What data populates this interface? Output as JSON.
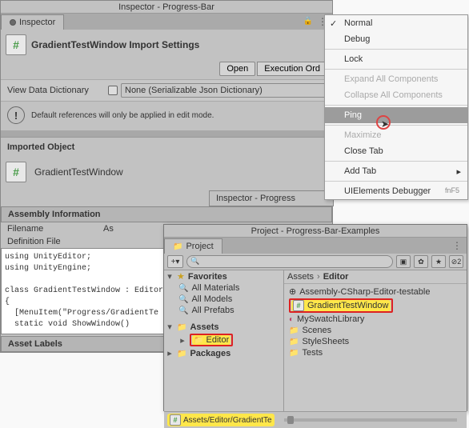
{
  "inspector": {
    "window_title": "Inspector - Progress-Bar",
    "tab_label": "Inspector",
    "header": "GradientTestWindow Import Settings",
    "open_btn": "Open",
    "exec_btn": "Execution Ord",
    "view_data_label": "View Data Dictionary",
    "view_data_value": "None (Serializable Json Dictionary)",
    "info_msg": "Default references will only be applied in edit mode.",
    "imported_label": "Imported Object",
    "imported_name": "GradientTestWindow",
    "inner_tab": "Inspector - Progress",
    "assembly_hdr": "Assembly Information",
    "filename_k": "Filename",
    "filename_v": "As",
    "deffile_k": "Definition File",
    "code": "using UnityEditor;\nusing UnityEngine;\n\nclass GradientTestWindow : EditorW\n{\n  [MenuItem(\"Progress/GradientTe\n  static void ShowWindow()",
    "asset_labels": "Asset Labels"
  },
  "menu": {
    "normal": "Normal",
    "debug": "Debug",
    "lock": "Lock",
    "expand": "Expand All Components",
    "collapse": "Collapse All Components",
    "ping": "Ping",
    "maximize": "Maximize",
    "close": "Close Tab",
    "add": "Add Tab",
    "uidbg": "UIElements Debugger",
    "uidbg_key": "fnF5"
  },
  "project": {
    "window_title": "Project - Progress-Bar-Examples",
    "tab_label": "Project",
    "hidden_count": "2",
    "fav": "Favorites",
    "all_mat": "All Materials",
    "all_mod": "All Models",
    "all_pre": "All Prefabs",
    "assets": "Assets",
    "editor": "Editor",
    "packages": "Packages",
    "bc_assets": "Assets",
    "bc_editor": "Editor",
    "r1": "Assembly-CSharp-Editor-testable",
    "r2": "GradientTestWindow",
    "r3": "MySwatchLibrary",
    "r4": "Scenes",
    "r5": "StyleSheets",
    "r6": "Tests",
    "footer": "Assets/Editor/GradientTe"
  }
}
